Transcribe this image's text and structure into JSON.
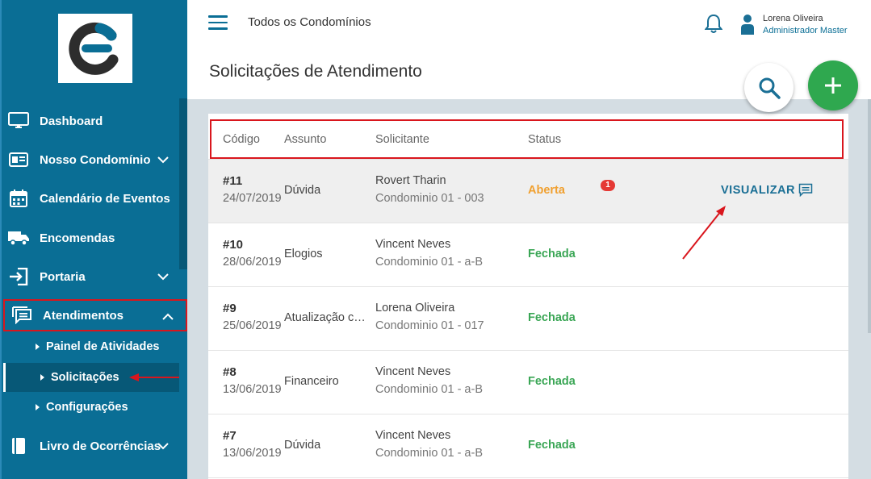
{
  "sidebar": {
    "items": [
      {
        "label": "Dashboard",
        "icon": "monitor-icon"
      },
      {
        "label": "Nosso Condomínio",
        "icon": "id-card-icon"
      },
      {
        "label": "Calendário de Eventos",
        "icon": "calendar-icon"
      },
      {
        "label": "Encomendas",
        "icon": "truck-icon"
      },
      {
        "label": "Portaria",
        "icon": "entry-icon"
      },
      {
        "label": "Atendimentos",
        "icon": "chat-icon"
      },
      {
        "label": "Livro de Ocorrências",
        "icon": "book-icon"
      }
    ],
    "subitems": [
      {
        "label": "Painel de Atividades"
      },
      {
        "label": "Solicitações"
      },
      {
        "label": "Configurações"
      }
    ]
  },
  "header": {
    "title": "Todos os Condomínios",
    "user_name": "Lorena Oliveira",
    "user_role": "Administrador Master"
  },
  "page": {
    "title": "Solicitações de Atendimento"
  },
  "table": {
    "columns": [
      "Código",
      "Assunto",
      "Solicitante",
      "Status"
    ],
    "rows": [
      {
        "code": "#11",
        "date": "24/07/2019",
        "subject": "Dúvida",
        "name": "Rovert Tharin",
        "unit": "Condominio 01 - 003",
        "status": "Aberta"
      },
      {
        "code": "#10",
        "date": "28/06/2019",
        "subject": "Elogios",
        "name": "Vincent Neves",
        "unit": "Condominio 01 - a-B",
        "status": "Fechada"
      },
      {
        "code": "#9",
        "date": "25/06/2019",
        "subject": "Atualização cadastral",
        "name": "Lorena Oliveira",
        "unit": "Condominio 01 - 017",
        "status": "Fechada"
      },
      {
        "code": "#8",
        "date": "13/06/2019",
        "subject": "Financeiro",
        "name": "Vincent Neves",
        "unit": "Condominio 01 - a-B",
        "status": "Fechada"
      },
      {
        "code": "#7",
        "date": "13/06/2019",
        "subject": "Dúvida",
        "name": "Vincent Neves",
        "unit": "Condominio 01 - a-B",
        "status": "Fechada"
      }
    ],
    "action_label": "VISUALIZAR",
    "badge_count": "1"
  },
  "colors": {
    "sidebar": "#0a6e95",
    "open": "#f0a030",
    "closed": "#3aa655",
    "accent_green": "#2fa84f",
    "highlight": "#d9161d"
  }
}
